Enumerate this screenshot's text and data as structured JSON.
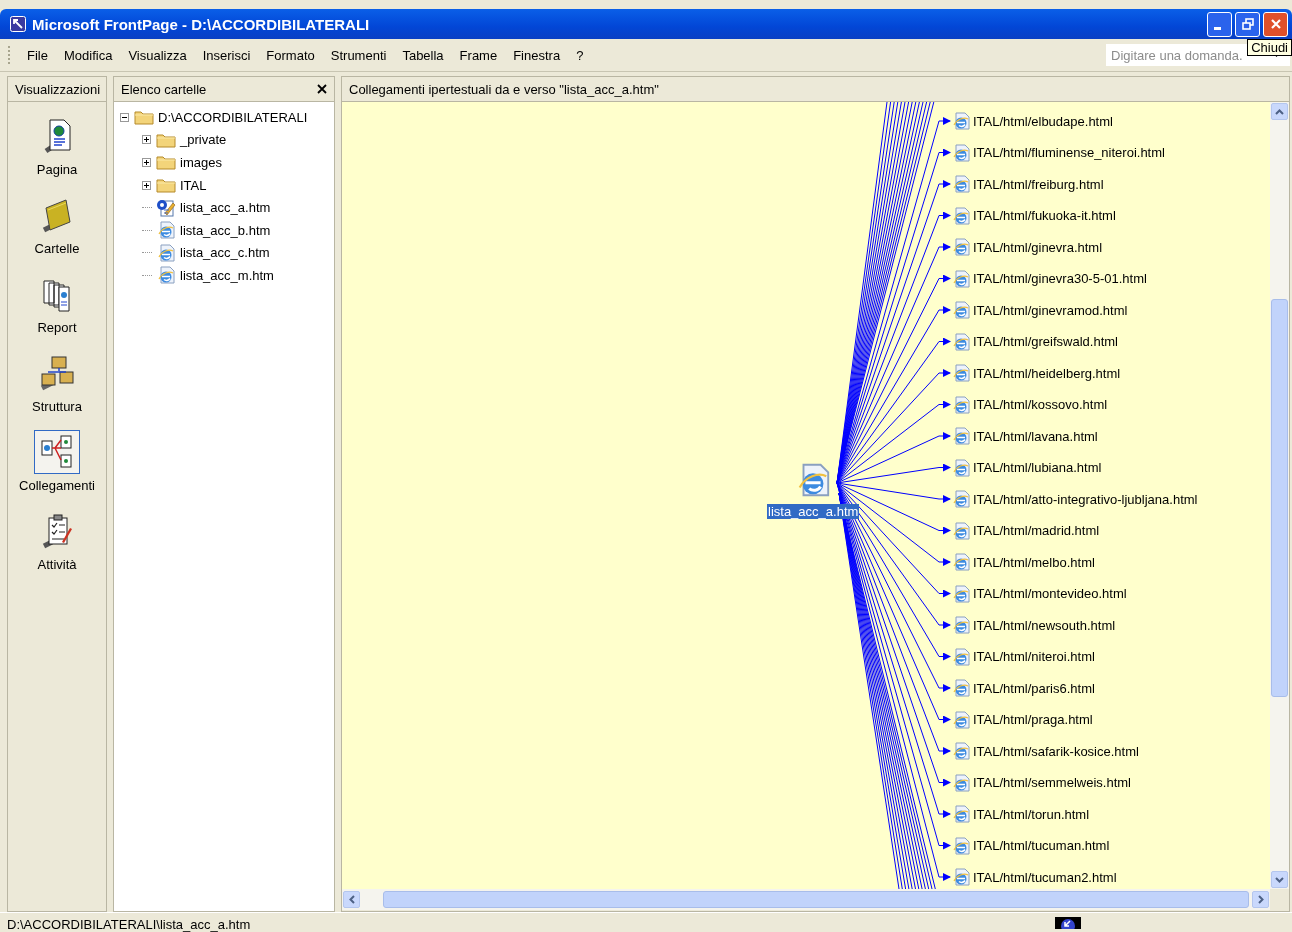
{
  "window": {
    "title": "Microsoft FrontPage - D:\\ACCORDIBILATERALI"
  },
  "menu": [
    {
      "label": "File"
    },
    {
      "label": "Modifica"
    },
    {
      "label": "Visualizza"
    },
    {
      "label": "Inserisci"
    },
    {
      "label": "Formato"
    },
    {
      "label": "Strumenti"
    },
    {
      "label": "Tabella"
    },
    {
      "label": "Frame"
    },
    {
      "label": "Finestra"
    },
    {
      "label": "?"
    }
  ],
  "help_box": {
    "placeholder": "Digitare una domanda."
  },
  "tooltip": "Chiudi",
  "views": {
    "title": "Visualizzazioni",
    "items": [
      {
        "label": "Pagina",
        "kind": "page",
        "selected": false
      },
      {
        "label": "Cartelle",
        "kind": "folders",
        "selected": false
      },
      {
        "label": "Report",
        "kind": "reports",
        "selected": false
      },
      {
        "label": "Struttura",
        "kind": "navigation",
        "selected": false
      },
      {
        "label": "Collegamenti",
        "kind": "hyperlinks",
        "selected": true
      },
      {
        "label": "Attività",
        "kind": "tasks",
        "selected": false
      }
    ]
  },
  "folder_list": {
    "title": "Elenco cartelle",
    "tree": [
      {
        "label": "D:\\ACCORDIBILATERALI",
        "kind": "folder",
        "expanded": true,
        "children": [
          {
            "label": "_private",
            "kind": "folder",
            "expanded": false
          },
          {
            "label": "images",
            "kind": "folder",
            "expanded": false
          },
          {
            "label": "ITAL",
            "kind": "folder",
            "expanded": false
          },
          {
            "label": "lista_acc_a.htm",
            "kind": "edited-page"
          },
          {
            "label": "lista_acc_b.htm",
            "kind": "page"
          },
          {
            "label": "lista_acc_c.htm",
            "kind": "page"
          },
          {
            "label": "lista_acc_m.htm",
            "kind": "page"
          }
        ]
      }
    ]
  },
  "hyperlinks": {
    "title": "Collegamenti ipertestuali da e verso \"lista_acc_a.htm\"",
    "center": "lista_acc_a.htm",
    "links": [
      "ITAL/html/elbudape.html",
      "ITAL/html/fluminense_niteroi.html",
      "ITAL/html/freiburg.html",
      "ITAL/html/fukuoka-it.html",
      "ITAL/html/ginevra.html",
      "ITAL/html/ginevra30-5-01.html",
      "ITAL/html/ginevramod.html",
      "ITAL/html/greifswald.html",
      "ITAL/html/heidelberg.html",
      "ITAL/html/kossovo.html",
      "ITAL/html/lavana.html",
      "ITAL/html/lubiana.html",
      "ITAL/html/atto-integrativo-ljubljana.html",
      "ITAL/html/madrid.html",
      "ITAL/html/melbo.html",
      "ITAL/html/montevideo.html",
      "ITAL/html/newsouth.html",
      "ITAL/html/niteroi.html",
      "ITAL/html/paris6.html",
      "ITAL/html/praga.html",
      "ITAL/html/safarik-kosice.html",
      "ITAL/html/semmelweis.html",
      "ITAL/html/torun.html",
      "ITAL/html/tucuman.html",
      "ITAL/html/tucuman2.html"
    ]
  },
  "status_bar": {
    "path": "D:\\ACCORDIBILATERALI\\lista_acc_a.htm"
  }
}
